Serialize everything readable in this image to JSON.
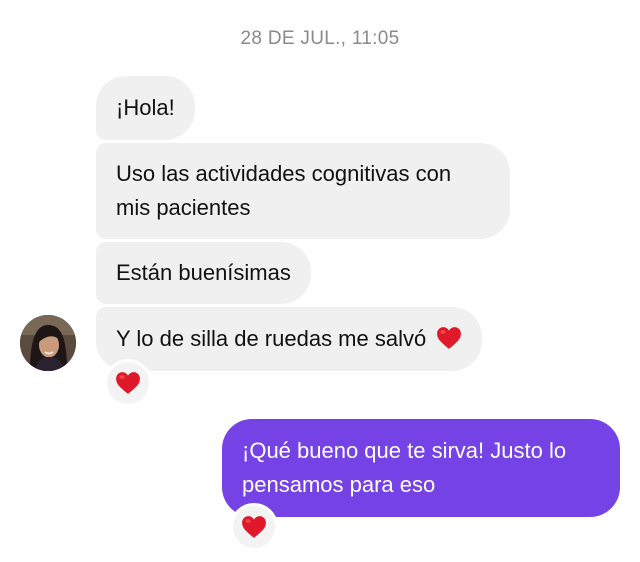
{
  "conversation": {
    "timestamp": "28 DE JUL., 11:05",
    "messages": [
      {
        "text": "¡Hola!",
        "direction": "incoming"
      },
      {
        "text": "Uso las actividades cognitivas con mis pacientes",
        "direction": "incoming"
      },
      {
        "text": "Están buenísimas",
        "direction": "incoming"
      },
      {
        "text": "Y lo de silla de ruedas me salvó",
        "direction": "incoming",
        "emoji": "heart-emoji"
      },
      {
        "text": "¡Qué bueno que te sirva! Justo lo pensamos para eso",
        "direction": "outgoing"
      }
    ],
    "reactions": [
      {
        "emoji": "heart-emoji",
        "on_message": 4
      },
      {
        "emoji": "heart-emoji",
        "on_message": 5
      }
    ]
  },
  "colors": {
    "incoming_bubble": "#f0f0f0",
    "outgoing_bubble": "#7542e6",
    "timestamp_text": "#8a8a8a",
    "heart": "#e0192a"
  },
  "icons": {
    "avatar": "contact-profile-photo",
    "reaction": "red-heart-icon"
  }
}
